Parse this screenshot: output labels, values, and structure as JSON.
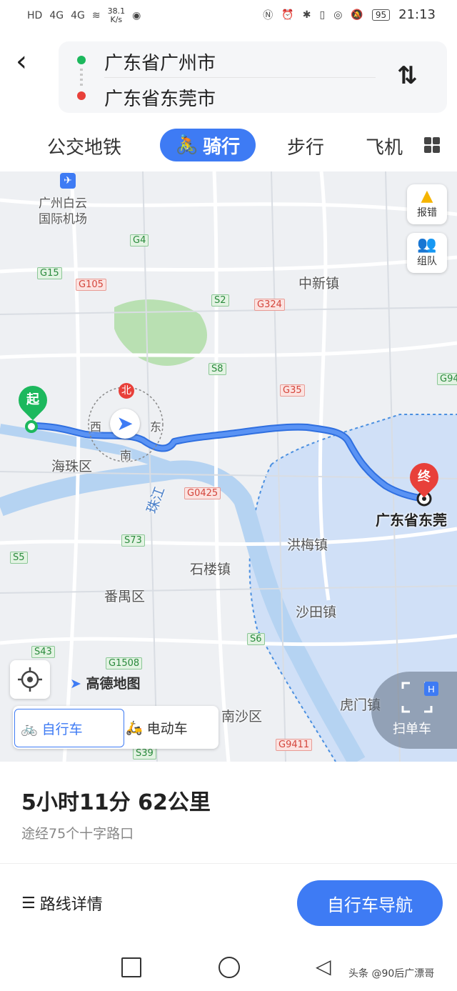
{
  "status_bar": {
    "left_items": [
      "HD",
      "4G",
      "4G"
    ],
    "net_speed": "38.1",
    "net_unit": "K/s",
    "battery": "95",
    "time": "21:13"
  },
  "route": {
    "origin": "广东省广州市",
    "destination": "广东省东莞市"
  },
  "tabs": {
    "transit": "公交地铁",
    "cycling": "骑行",
    "walking": "步行",
    "flight": "飞机"
  },
  "map": {
    "place_labels": [
      "广州白云",
      "国际机场",
      "中新镇",
      "海珠区",
      "洪梅镇",
      "石楼镇",
      "番禺区",
      "沙田镇",
      "虎门镇",
      "南沙区"
    ],
    "river_label": "珠江",
    "road_labels_red": [
      "G105",
      "G324",
      "G35",
      "G0425",
      "G1508",
      "G9411"
    ],
    "road_labels_green": [
      "G4",
      "G15",
      "S2",
      "S8",
      "S73",
      "S5",
      "S6",
      "S43",
      "S39",
      "G94"
    ],
    "compass": {
      "north": "北",
      "south": "南",
      "east": "东",
      "west": "西"
    },
    "start_marker": "起",
    "end_marker": "终",
    "destination_label": "广东省东莞",
    "report_button": "报错",
    "team_button": "组队",
    "brand": "高德地图",
    "bike_option": "自行车",
    "ebike_option": "电动车",
    "scan_button": "扫单车"
  },
  "summary": {
    "duration_distance": "5小时11分  62公里",
    "via": "途经75个十字路口"
  },
  "actions": {
    "route_detail": "路线详情",
    "navigate": "自行车导航"
  },
  "watermark": "头条 @90后广漂哥",
  "colors": {
    "accent": "#3e7bf4",
    "start": "#1cb85d",
    "end": "#e8403a"
  }
}
